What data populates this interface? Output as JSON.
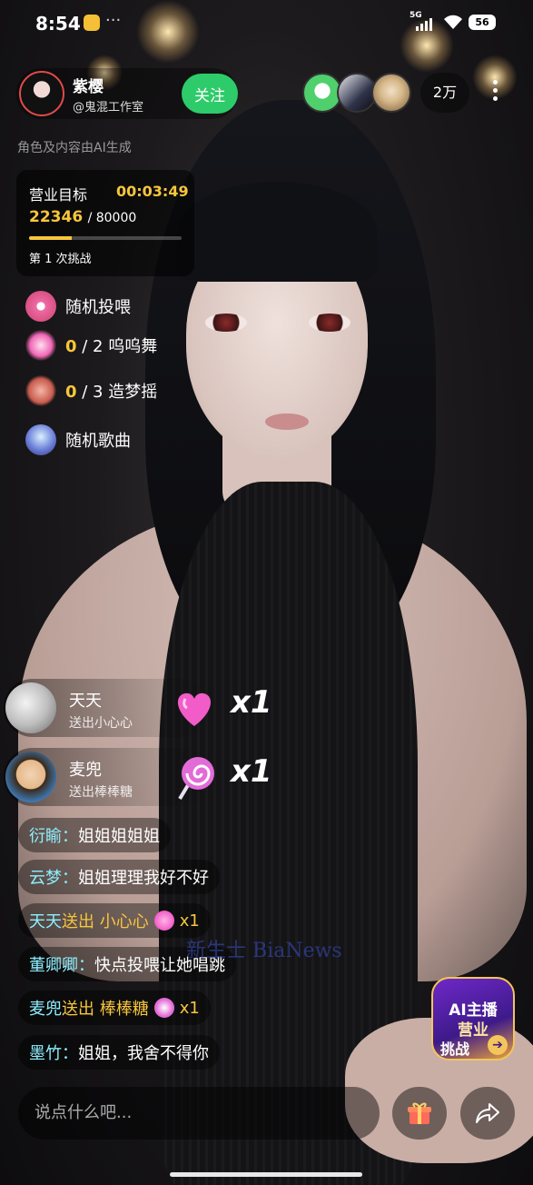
{
  "status": {
    "time": "8:54",
    "network": "5G",
    "battery": "56"
  },
  "host": {
    "name": "紫樱",
    "handle": "@鬼混工作室",
    "follow_label": "关注"
  },
  "audience": {
    "count": "2万"
  },
  "ai_notice": "角色及内容由AI生成",
  "goal": {
    "title": "营业目标",
    "timer": "00:03:49",
    "current": "22346",
    "total": "/ 80000",
    "progress": 0.279,
    "attempt": "第 1 次挑战"
  },
  "tasks": [
    {
      "icon": "donut-gift-icon",
      "label": "随机投喂"
    },
    {
      "icon": "firework-gift-icon",
      "count": "0",
      "rest": " / 2 呜呜舞"
    },
    {
      "icon": "flower-gift-icon",
      "count": "0",
      "rest": " / 3 造梦摇"
    },
    {
      "icon": "music-globe-icon",
      "label": "随机歌曲"
    }
  ],
  "gifts": [
    {
      "name": "天天",
      "action": "送出小心心",
      "icon": "heart-gift-icon",
      "multiplier": "x1"
    },
    {
      "name": "麦兜",
      "action": "送出棒棒糖",
      "icon": "lollipop-gift-icon",
      "multiplier": "x1"
    }
  ],
  "chat": [
    {
      "user": "衍睮：",
      "text": "姐姐姐姐姐"
    },
    {
      "user": "云梦：",
      "text": "姐姐理理我好不好"
    },
    {
      "user": "天天",
      "gift_text": " 送出 小心心",
      "mult": "x1"
    },
    {
      "user": "董卿卿：",
      "text": "快点投喂让她唱跳"
    },
    {
      "user": "麦兜",
      "gift_text": " 送出 棒棒糖",
      "mult": "x1"
    },
    {
      "user": "墨竹：",
      "text": "姐姐，我舍不得你"
    }
  ],
  "watermark": "新生士 BiaNews",
  "badge": {
    "line1": "AI主播",
    "line2": "营业",
    "line3": "挑战"
  },
  "input": {
    "placeholder": "说点什么吧..."
  },
  "colors": {
    "accent": "#f7c63d",
    "follow": "#2ecb6a",
    "chat_user": "#8ef0ff"
  }
}
